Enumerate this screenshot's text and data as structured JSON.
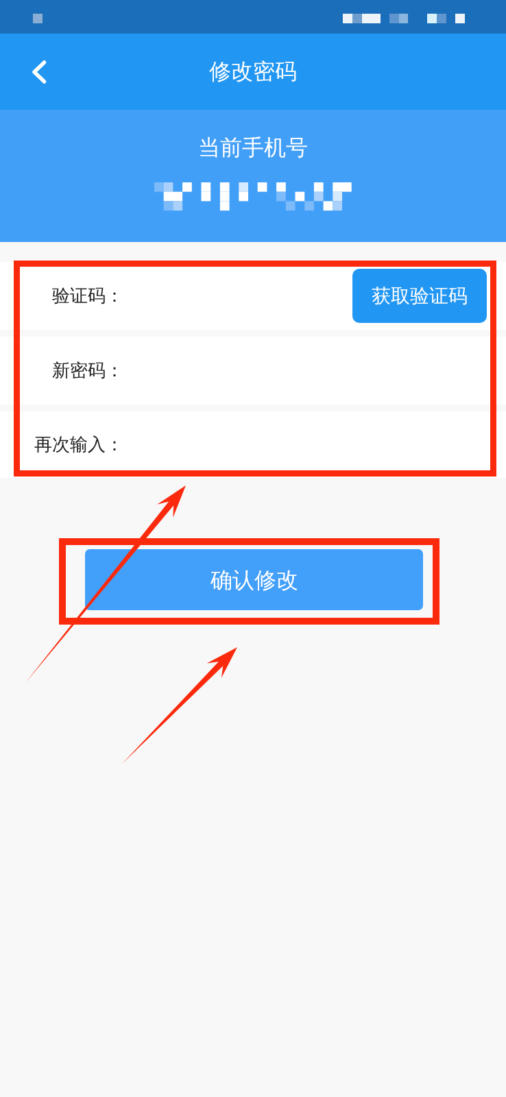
{
  "header": {
    "title": "修改密码"
  },
  "phone_panel": {
    "label": "当前手机号"
  },
  "form": {
    "rows": [
      {
        "kind": "code",
        "label": "验证码：",
        "button": "获取验证码"
      },
      {
        "kind": "plain",
        "label": "新密码："
      },
      {
        "kind": "plain",
        "label": "再次输入："
      }
    ]
  },
  "submit_button": "确认修改"
}
